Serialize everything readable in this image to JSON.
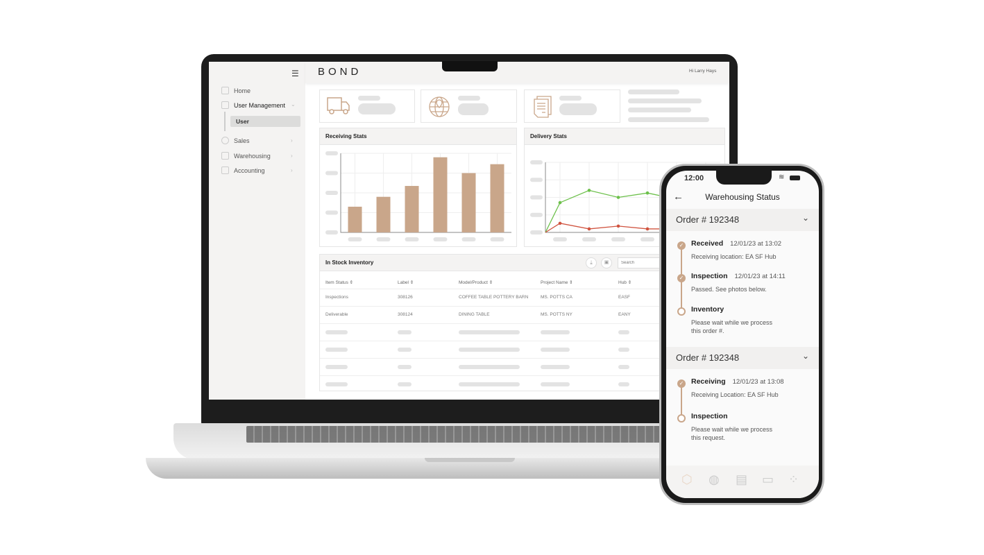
{
  "laptop": {
    "brand": "BOND",
    "greeting": "Hi Larry Hays",
    "sidebar": {
      "items": [
        {
          "label": "Home",
          "icon": "grid-icon"
        },
        {
          "label": "User Management",
          "icon": "id-card-icon",
          "expanded": true,
          "children": [
            {
              "label": "User",
              "active": true
            }
          ]
        },
        {
          "label": "Sales",
          "icon": "globe-icon"
        },
        {
          "label": "Warehousing",
          "icon": "box-icon"
        },
        {
          "label": "Accounting",
          "icon": "calendar-icon"
        }
      ]
    },
    "stat_cards": [
      {
        "icon": "truck-icon"
      },
      {
        "icon": "globe-pin-icon"
      },
      {
        "icon": "documents-icon"
      }
    ],
    "receiving_stats": {
      "title": "Receiving Stats"
    },
    "delivery_stats": {
      "title": "Delivery Stats"
    },
    "inventory": {
      "title": "In Stock Inventory",
      "search_placeholder": "Search",
      "columns": [
        "Item Status",
        "Label",
        "Model/Product",
        "Project Name",
        "Hub"
      ],
      "rows": [
        [
          "Inspections",
          "308126",
          "COFFEE TABLE POTTERY BARN",
          "MS. POTTS CA",
          "EASF"
        ],
        [
          "Deliverable",
          "308124",
          "DINING TABLE",
          "MS. POTTS NY",
          "EANY"
        ]
      ]
    }
  },
  "chart_data": [
    {
      "type": "bar",
      "title": "Receiving Stats",
      "values": [
        1.3,
        1.8,
        2.35,
        3.8,
        3.0,
        3.45
      ],
      "ylim": [
        0,
        4
      ],
      "grid": true,
      "colors": [
        "#c9a68a"
      ]
    },
    {
      "type": "line",
      "title": "Delivery Stats",
      "ylim": [
        0,
        4
      ],
      "grid": true,
      "series": [
        {
          "color": "#6cc04a",
          "values": [
            0,
            1.7,
            2.4,
            2.0,
            2.25,
            1.9
          ]
        },
        {
          "color": "#d0533f",
          "values": [
            0,
            0.52,
            0.2,
            0.36,
            0.2,
            0.2
          ]
        }
      ]
    }
  ],
  "phone": {
    "time": "12:00",
    "title": "Warehousing Status",
    "orders": [
      {
        "label": "Order # 192348",
        "steps": [
          {
            "name": "Received",
            "date": "12/01/23 at 13:02",
            "desc": "Receiving location: EA SF Hub",
            "done": true
          },
          {
            "name": "Inspection",
            "date": "12/01/23 at 14:11",
            "desc": "Passed. See photos below.",
            "done": true
          },
          {
            "name": "Inventory",
            "date": "",
            "desc": "Please wait while we process this order #.",
            "done": false
          }
        ]
      },
      {
        "label": "Order # 192348",
        "steps": [
          {
            "name": "Receiving",
            "date": "12/01/23 at 13:08",
            "desc": "Receiving Location: EA SF Hub",
            "done": true
          },
          {
            "name": "Inspection",
            "date": "",
            "desc": "Please wait while we process this request.",
            "done": false
          }
        ]
      }
    ],
    "tabbar": [
      "box-icon",
      "globe-icon",
      "id-card-icon",
      "calendar-icon",
      "grid-icon"
    ]
  },
  "colors": {
    "accent": "#c9a68a",
    "green": "#6cc04a",
    "red": "#d0533f"
  }
}
